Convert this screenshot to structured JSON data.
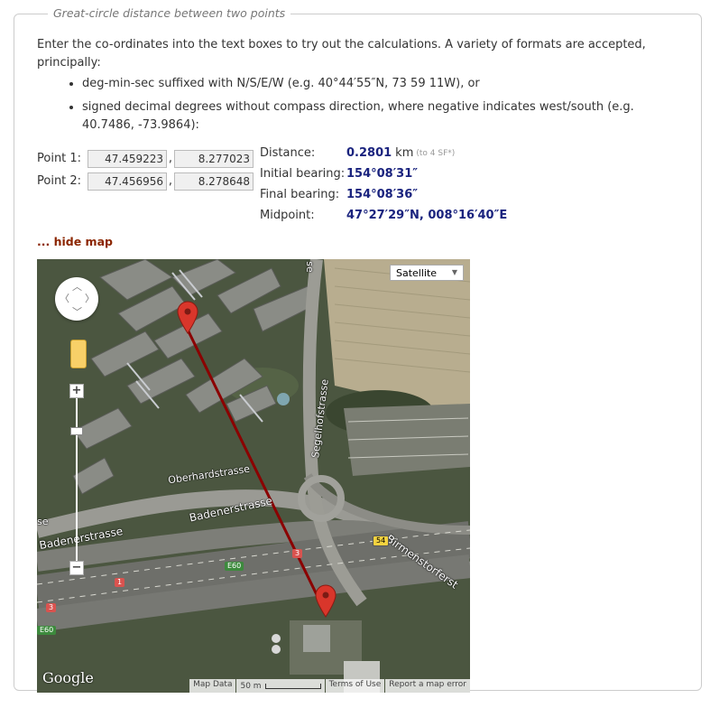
{
  "legend": "Great-circle distance between two points",
  "intro": {
    "text": "Enter the co-ordinates into the text boxes to try out the calculations. A variety of formats are accepted, principally:",
    "bullets": [
      "deg-min-sec suffixed with N/S/E/W (e.g. 40°44′55″N, 73 59 11W), or",
      "signed decimal degrees without compass direction, where negative indicates west/south (e.g. 40.7486, -73.9864):"
    ]
  },
  "points": {
    "p1": {
      "label": "Point 1:",
      "lat": "47.459223",
      "lon": "8.277023"
    },
    "p2": {
      "label": "Point 2:",
      "lat": "47.456956",
      "lon": "8.278648"
    },
    "separator": ","
  },
  "results": {
    "distance_label": "Distance:",
    "distance_value": "0.2801",
    "distance_unit": "km",
    "distance_note": "(to 4 SF*)",
    "initial_label": "Initial bearing:",
    "initial_value": "154°08′31″",
    "final_label": "Final bearing:",
    "final_value": "154°08′36″",
    "midpoint_label": "Midpoint:",
    "midpoint_value": "47°27′29″N, 008°16′40″E"
  },
  "hide_map": "... hide map",
  "map": {
    "type_selector": "Satellite",
    "zoom_in": "+",
    "zoom_out": "−",
    "logo": "Google",
    "attribution": {
      "map_data": "Map Data",
      "scale": "50 m",
      "terms": "Terms of Use",
      "report": "Report a map error"
    },
    "streets": {
      "oberhardstrasse": "Oberhardstrasse",
      "badenerstrasse_upper": "Badenerstrasse",
      "badenerstrasse_lower": "Badenerstrasse",
      "segelhofstrasse": "Segelhofstrasse",
      "birmenstorfer": "Birmenstorferst",
      "se_fragment": "se",
      "top_fragment": "se"
    },
    "shields": {
      "e60_a": "E60",
      "e60_b": "E60",
      "r1": "1",
      "r3_a": "3",
      "r3_b": "3",
      "r54": "54"
    },
    "colors": {
      "route_line": "#8b0000",
      "marker": "#d9362b"
    }
  }
}
